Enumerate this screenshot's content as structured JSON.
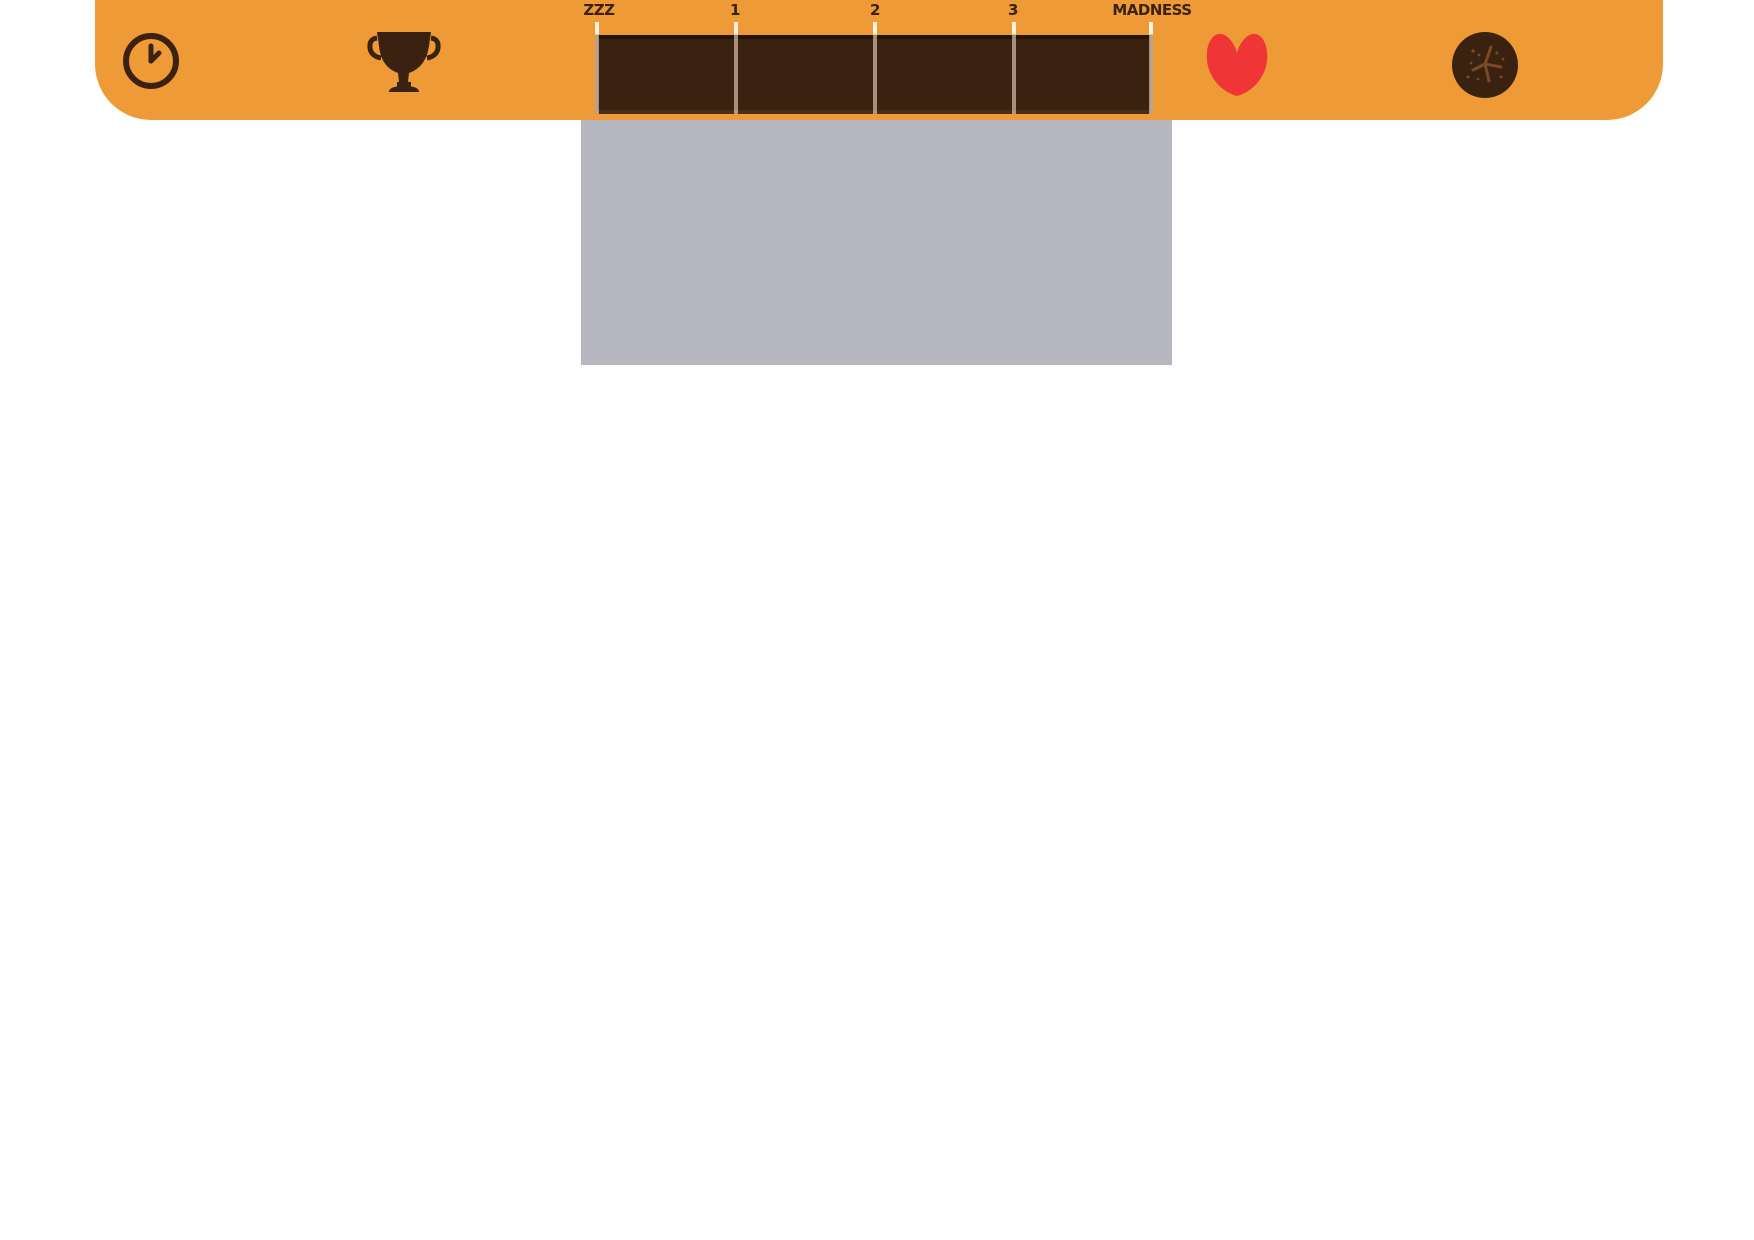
{
  "hud": {
    "background_color": "#ee9a36",
    "icons": {
      "left": "clock-icon",
      "left_center": "trophy-icon",
      "right_center": "heart-icon",
      "right": "cookie-icon"
    },
    "heart_color": "#ef3535",
    "ink_color": "#3b2210"
  },
  "meter": {
    "labels": [
      "ZZZ",
      "1",
      "2",
      "3",
      "MADNESS"
    ],
    "level": 0,
    "track_color": "#3b2210"
  },
  "stage": {
    "color": "#b7b7c1"
  }
}
